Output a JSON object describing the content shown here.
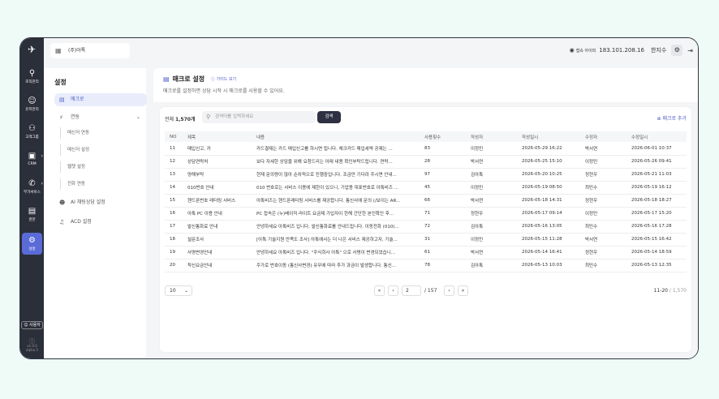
{
  "rail": {
    "items": [
      {
        "icon": "org-icon",
        "label": "조직관리"
      },
      {
        "icon": "user-icon",
        "label": "유저관리"
      },
      {
        "icon": "group-icon",
        "label": "고객그룹"
      },
      {
        "icon": "crm-icon",
        "label": "CRM"
      },
      {
        "icon": "addon-icon",
        "label": "부가서비스"
      },
      {
        "icon": "lock-icon",
        "label": "권한"
      },
      {
        "icon": "gear-icon",
        "label": "설정"
      }
    ],
    "user_label": "사용자",
    "version": "v1.0.0\nalpha.5"
  },
  "header": {
    "company": "(주)아톡",
    "ip_label": "접속 아이피",
    "ip": "183.101.208.16",
    "user_name": "한지수"
  },
  "sidebar": {
    "title": "설정",
    "items": [
      {
        "label": "매크로"
      },
      {
        "label": "연동"
      },
      {
        "label": "메신저 연동"
      },
      {
        "label": "메신저 설정"
      },
      {
        "label": "웹챗 설정"
      },
      {
        "label": "전화 연동"
      },
      {
        "label": "AI 채팅상담 설정"
      },
      {
        "label": "ACD 설정"
      }
    ]
  },
  "page": {
    "title": "매크로 설정",
    "guide": "가이드 보기",
    "description": "매크로를 설정하면 상담 시작 시 매크로를 사용할 수 있어요."
  },
  "toolbar": {
    "total_prefix": "전체",
    "total": "1,570개",
    "search_placeholder": "검색어를 입력하세요",
    "search_button": "검색",
    "add_button": "매크로 추가"
  },
  "table": {
    "headers": [
      "NO",
      "제목",
      "내용",
      "사용횟수",
      "작성자",
      "작성일시",
      "수정자",
      "수정일시"
    ],
    "rows": [
      [
        "11",
        "매입신고, 카",
        "카드결제는 카드 매입신고를 하시면 됩니다. 체크카드 매입세액 공제는 ...",
        "83",
        "이정민",
        "2026-05-29 16:22",
        "박서연",
        "2026-06-01 10:37"
      ],
      [
        "12",
        "상담연락처",
        "보다 자세한 상담을 위해 요청드리는 아래 내용 확인부탁드립니다. 연락...",
        "28",
        "박서연",
        "2026-05-25 15:10",
        "이정민",
        "2026-05-26 09:41"
      ],
      [
        "13",
        "양해부탁",
        "현재 문의량이 많아 순차적으로 진행중입니다. 조금만 기다려 주시면 안내...",
        "97",
        "김아톡",
        "2026-05-20 10:25",
        "정현우",
        "2026-05-21 11:03"
      ],
      [
        "14",
        "010번호 안내",
        "010 번호로는 서비스 이용에 제한이 있으니, 기업용 대표번호로 아톡비즈 ...",
        "45",
        "이정민",
        "2026-05-19 08:50",
        "최민수",
        "2026-05-19 16:12"
      ],
      [
        "15",
        "핸드폰번호 레터링 서비스",
        "아톡비즈는 핸드폰레터링 서비스를 제공합니다. 통신사에 문의 (/보이는 AR...",
        "66",
        "박서연",
        "2026-05-18 14:31",
        "정현우",
        "2026-05-18 18:27"
      ],
      [
        "16",
        "아톡 PC 이용 안내",
        "PC 접속은 (누)베이직·라이트 요금제 가입자이 한해 간단한 본인확인 후...",
        "71",
        "정현우",
        "2026-05-17 09:14",
        "이정민",
        "2026-05-17 15:20"
      ],
      [
        "17",
        "발신통화료 안내",
        "안녕하세요 아톡비즈 입니다. 발신통화료를 안내드립니다. 이동전화 (010)...",
        "72",
        "김아톡",
        "2026-05-16 13:05",
        "최민수",
        "2026-05-16 17:28"
      ],
      [
        "18",
        "설문조사",
        "[아톡 기술지원 만족도 조사] 아톡에서는 더 나은 서비스 제공하고자, 기술...",
        "31",
        "이정민",
        "2026-05-15 11:28",
        "박서연",
        "2026-05-15 16:42"
      ],
      [
        "19",
        "사명변경안내",
        "안녕하세요 아톡비즈 입니다. \"주식회사 아톡\" 으로 사명이 변경되었습니...",
        "61",
        "박서연",
        "2026-05-14 16:41",
        "정현우",
        "2026-05-14 18:59"
      ],
      [
        "20",
        "착신요금안내",
        "주가로 번호이동 (통신사변경) 유무에 따라 추가 과금이 발생합니다. 통신...",
        "78",
        "김아톡",
        "2026-05-13 10:03",
        "최민수",
        "2026-05-13 12:35"
      ]
    ]
  },
  "pagination": {
    "page_size": "10",
    "current": "2",
    "total_pages": "/ 157",
    "range": "11-20",
    "total": "/ 1,570"
  }
}
